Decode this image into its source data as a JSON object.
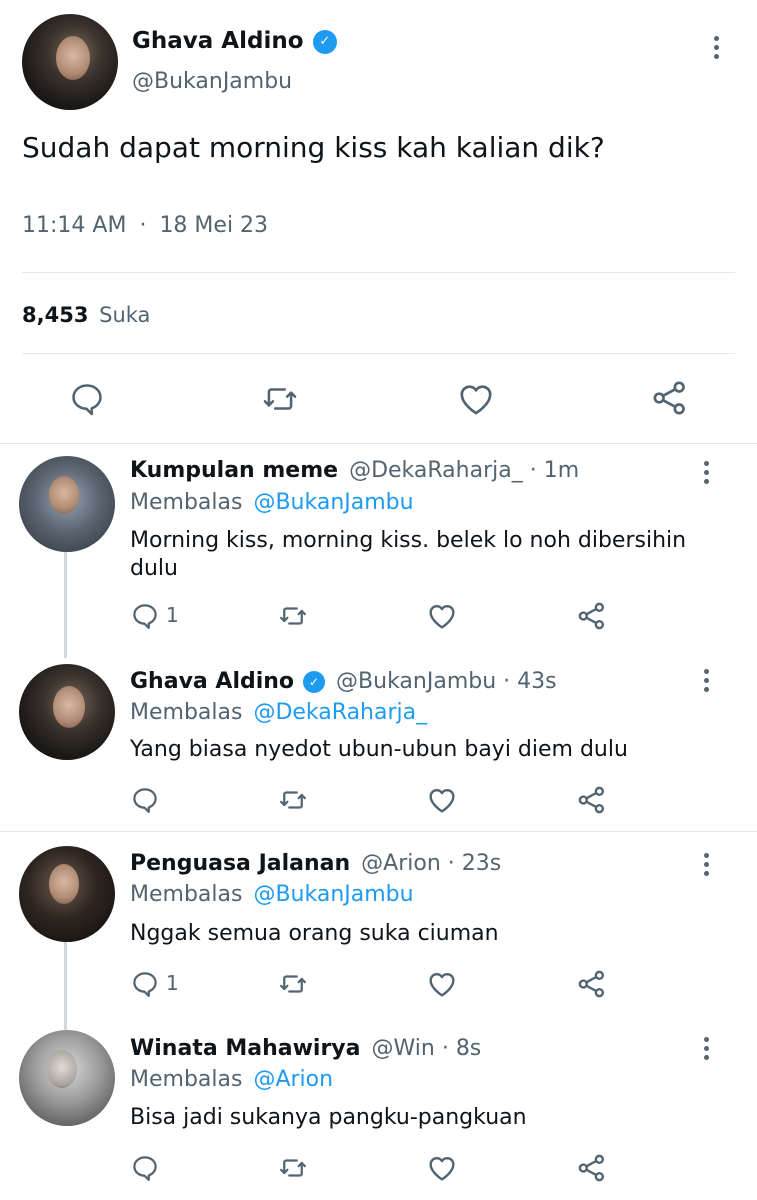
{
  "main_tweet": {
    "name": "Ghava Aldino",
    "handle": "@BukanJambu",
    "text": "Sudah dapat morning kiss kah kalian dik?",
    "time": "11:14 AM",
    "separator": "·",
    "date": "18 Mei 23",
    "likes_count": "8,453",
    "likes_label": "Suka"
  },
  "replies": [
    {
      "name": "Kumpulan meme",
      "verified": false,
      "handle": "@DekaRaharja_",
      "dot": "·",
      "age": "1m",
      "replying_label": "Membalas",
      "replying_to": "@BukanJambu",
      "text": "Morning kiss, morning kiss. belek lo noh dibersihin dulu",
      "reply_count": "1"
    },
    {
      "name": "Ghava Aldino",
      "verified": true,
      "handle": "@BukanJambu",
      "dot": "·",
      "age": "43s",
      "replying_label": "Membalas",
      "replying_to": "@DekaRaharja_",
      "text": "Yang biasa nyedot ubun-ubun bayi diem dulu",
      "reply_count": ""
    },
    {
      "name": "Penguasa Jalanan",
      "verified": false,
      "handle": "@Arion",
      "dot": "·",
      "age": "23s",
      "replying_label": "Membalas",
      "replying_to": "@BukanJambu",
      "text": "Nggak semua orang suka ciuman",
      "reply_count": "1"
    },
    {
      "name": "Winata Mahawirya",
      "verified": false,
      "handle": "@Win",
      "dot": "·",
      "age": "8s",
      "replying_label": "Membalas",
      "replying_to": "@Arion",
      "text": "Bisa jadi sukanya pangku-pangkuan",
      "reply_count": ""
    }
  ],
  "icons": {
    "verified_glyph": "✓",
    "accent": "#1d9bf0",
    "icon_color": "#536471"
  }
}
